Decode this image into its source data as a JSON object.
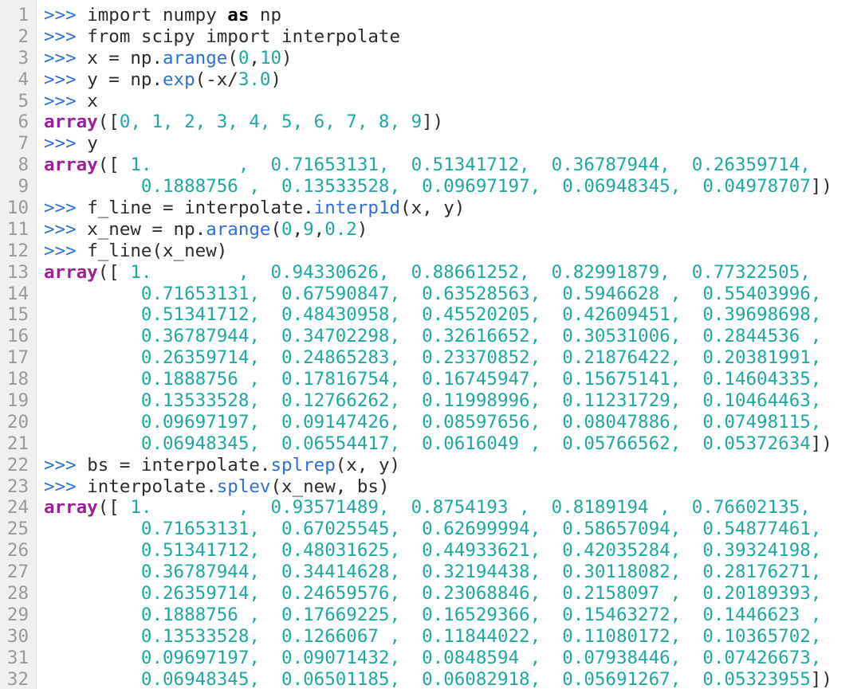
{
  "line_numbers": [
    "1",
    "2",
    "3",
    "4",
    "5",
    "6",
    "7",
    "8",
    "9",
    "10",
    "11",
    "12",
    "13",
    "14",
    "15",
    "16",
    "17",
    "18",
    "19",
    "20",
    "21",
    "22",
    "23",
    "24",
    "25",
    "26",
    "27",
    "28",
    "29",
    "30",
    "31",
    "32"
  ],
  "code": {
    "prompt": ">>>",
    "l1": {
      "a": "import numpy ",
      "kw": "as",
      "b": " np"
    },
    "l2": {
      "a": "from scipy import interpolate"
    },
    "l3": {
      "a": "x = np.",
      "fn": "arange",
      "b": "(",
      "n1": "0",
      "c": ",",
      "n2": "10",
      "d": ")"
    },
    "l4": {
      "a": "y = np.",
      "fn": "exp",
      "b": "(-x/",
      "n1": "3.0",
      "c": ")"
    },
    "l5": {
      "a": "x"
    },
    "l6": {
      "arr": "array",
      "a": "([",
      "vals": "0, 1, 2, 3, 4, 5, 6, 7, 8, 9",
      "b": "])"
    },
    "l7": {
      "a": "y"
    },
    "l8": {
      "arr": "array",
      "a": "([ ",
      "vals": "1.        ,  0.71653131,  0.51341712,  0.36787944,  0.26359714,"
    },
    "l9": {
      "vals": "0.1888756 ,  0.13533528,  0.09697197,  0.06948345,  0.04978707",
      "b": "])"
    },
    "l10": {
      "a": "f_line = interpolate.",
      "fn": "interp1d",
      "b": "(x, y)"
    },
    "l11": {
      "a": "x_new = np.",
      "fn": "arange",
      "b": "(",
      "n1": "0",
      "c": ",",
      "n2": "9",
      "d": ",",
      "n3": "0.2",
      "e": ")"
    },
    "l12": {
      "a": "f_line(x_new)"
    },
    "l13": {
      "arr": "array",
      "a": "([ ",
      "vals": "1.        ,  0.94330626,  0.88661252,  0.82991879,  0.77322505,"
    },
    "l14": {
      "vals": "0.71653131,  0.67590847,  0.63528563,  0.5946628 ,  0.55403996,"
    },
    "l15": {
      "vals": "0.51341712,  0.48430958,  0.45520205,  0.42609451,  0.39698698,"
    },
    "l16": {
      "vals": "0.36787944,  0.34702298,  0.32616652,  0.30531006,  0.2844536 ,"
    },
    "l17": {
      "vals": "0.26359714,  0.24865283,  0.23370852,  0.21876422,  0.20381991,"
    },
    "l18": {
      "vals": "0.1888756 ,  0.17816754,  0.16745947,  0.15675141,  0.14604335,"
    },
    "l19": {
      "vals": "0.13533528,  0.12766262,  0.11998996,  0.11231729,  0.10464463,"
    },
    "l20": {
      "vals": "0.09697197,  0.09147426,  0.08597656,  0.08047886,  0.07498115,"
    },
    "l21": {
      "vals": "0.06948345,  0.06554417,  0.0616049 ,  0.05766562,  0.05372634",
      "b": "])"
    },
    "l22": {
      "a": "bs = interpolate.",
      "fn": "splrep",
      "b": "(x, y)"
    },
    "l23": {
      "a": "interpolate.",
      "fn": "splev",
      "b": "(x_new, bs)"
    },
    "l24": {
      "arr": "array",
      "a": "([ ",
      "vals": "1.        ,  0.93571489,  0.8754193 ,  0.8189194 ,  0.76602135,"
    },
    "l25": {
      "vals": "0.71653131,  0.67025545,  0.62699994,  0.58657094,  0.54877461,"
    },
    "l26": {
      "vals": "0.51341712,  0.48031625,  0.44933621,  0.42035284,  0.39324198,"
    },
    "l27": {
      "vals": "0.36787944,  0.34414628,  0.32194438,  0.30118082,  0.28176271,"
    },
    "l28": {
      "vals": "0.26359714,  0.24659576,  0.23068846,  0.2158097 ,  0.20189393,"
    },
    "l29": {
      "vals": "0.1888756 ,  0.17669225,  0.16529366,  0.15463272,  0.1446623 ,"
    },
    "l30": {
      "vals": "0.13533528,  0.1266067 ,  0.11844022,  0.11080172,  0.10365702,"
    },
    "l31": {
      "vals": "0.09697197,  0.09071432,  0.0848594 ,  0.07938446,  0.07426673,"
    },
    "l32": {
      "vals": "0.06948345,  0.06501185,  0.06082918,  0.05691267,  0.05323955",
      "b": "])"
    }
  },
  "colors": {
    "prompt": "#2f6fd8",
    "number": "#1fa8a0",
    "array_keyword": "#9b1f9b",
    "gutter_bg": "#f0f0f0",
    "line_number": "#9a9a9a"
  }
}
